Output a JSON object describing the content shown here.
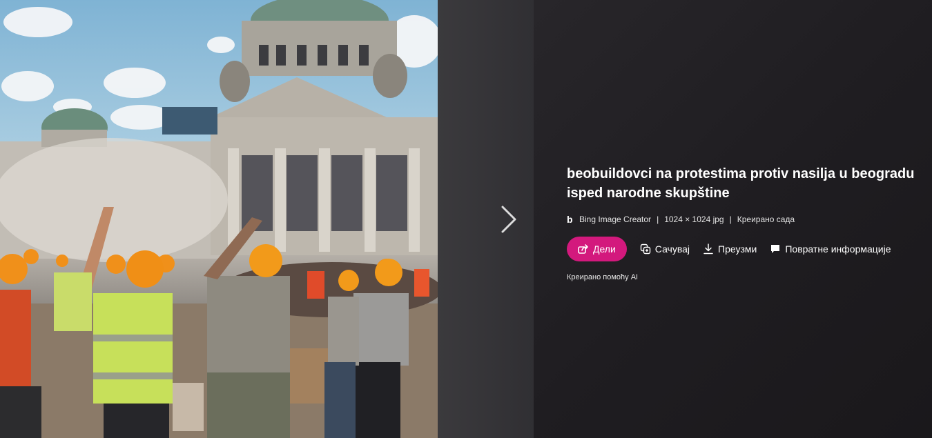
{
  "image": {
    "content": "Generated image of construction workers in hard hats and safety vests protesting in front of the National Assembly building"
  },
  "navigation": {
    "next_icon": "chevron-right-icon"
  },
  "details": {
    "title": "beobuildovci na protestima protiv nasilja u beogradu isped narodne skupštine",
    "meta": {
      "creator_icon": "bing-icon",
      "creator": "Bing Image Creator",
      "separator": "|",
      "dimensions": "1024 × 1024 jpg",
      "created": "Креирано сада"
    },
    "actions": {
      "share": "Дели",
      "save": "Сачувај",
      "download": "Преузми",
      "feedback": "Повратне информације"
    },
    "ai_note": "Креирано помоћу AI"
  },
  "colors": {
    "share_button": "#d3197d",
    "panel_background": "#1f1d21"
  }
}
